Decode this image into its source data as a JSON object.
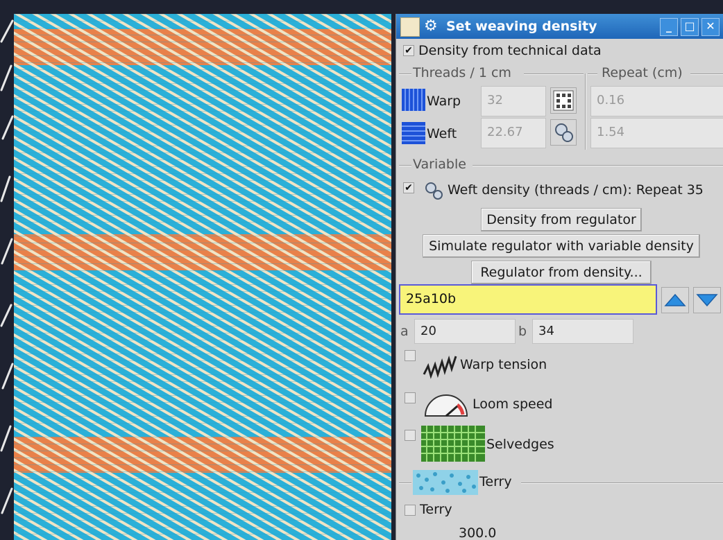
{
  "dialog": {
    "title": "Set weaving density",
    "density_from_technical_data": {
      "label": "Density from technical data",
      "checked": true
    },
    "threads_group_label": "Threads / 1 cm",
    "repeat_group_label": "Repeat (cm)",
    "warp": {
      "label": "Warp",
      "threads": "32",
      "repeat": "0.16"
    },
    "weft": {
      "label": "Weft",
      "threads": "22.67",
      "repeat": "1.54"
    },
    "variable_group_label": "Variable",
    "weft_density": {
      "label": "Weft density (threads / cm): Repeat 35",
      "checked": true
    },
    "buttons": {
      "density_from_regulator": "Density from regulator",
      "simulate_regulator": "Simulate regulator with variable density",
      "regulator_from_density": "Regulator from density..."
    },
    "pattern_input": "25a10b",
    "a_label": "a",
    "a_value": "20",
    "b_label": "b",
    "b_value": "34",
    "warp_tension": {
      "label": "Warp tension",
      "checked": false
    },
    "loom_speed": {
      "label": "Loom speed",
      "checked": false
    },
    "selvedges": {
      "label": "Selvedges",
      "checked": false
    },
    "terry_group_label": "Terry",
    "terry": {
      "label": "Terry",
      "checked": false
    },
    "terry_value": "300.0",
    "window_buttons": {
      "minimize": "_",
      "maximize": "□",
      "close": "✕"
    },
    "check_mark": "✔"
  },
  "colors": {
    "titlebar": "#1f66b8",
    "fabric_blue": "#2bb0d8",
    "fabric_orange": "#e8814a",
    "fabric_cream": "#efe4c6",
    "highlight_input": "#f8f47a"
  },
  "icons": {
    "title": "gear-icon",
    "warp": "warp-threads-icon",
    "weft": "weft-threads-icon",
    "repeat_warp": "repeat-grid-icon",
    "repeat_weft": "regulator-gears-icon",
    "weft_density": "gears-icon",
    "up": "arrow-up-icon",
    "down": "arrow-down-icon",
    "warp_tension": "spring-icon",
    "loom_speed": "speedometer-icon",
    "selvedges": "selvedge-grid-icon",
    "terry": "terry-texture-icon"
  }
}
